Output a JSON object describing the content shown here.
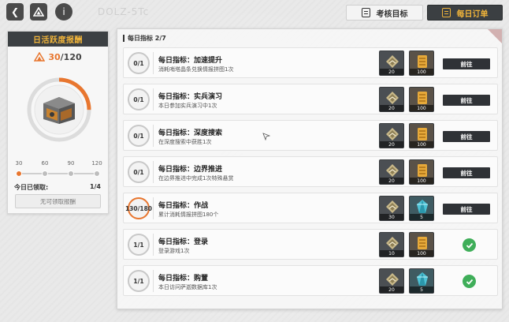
{
  "topbar": {
    "title": "DOLZ-5Tc",
    "tabs": [
      {
        "label": "考核目标",
        "active": false
      },
      {
        "label": "每日订单",
        "active": true
      }
    ]
  },
  "activity": {
    "header": "日活跃度报酬",
    "current": "30",
    "max": "/120",
    "progress_fraction": 0.25,
    "milestones": [
      "30",
      "60",
      "90",
      "120"
    ],
    "today_label": "今日已领取:",
    "today_value": "1/4",
    "claim_button": "无可领取报酬"
  },
  "list": {
    "header": "每日指标 2/7",
    "tasks": [
      {
        "progress": "0/1",
        "title": "每日指标：加速提升",
        "desc": "消耗哨塔晶条兑换情报拼图1次",
        "rewards": [
          {
            "type": "rank-chip",
            "qty": "20"
          },
          {
            "type": "gold-card",
            "qty": "100"
          }
        ],
        "status": "go",
        "button": "前往"
      },
      {
        "progress": "0/1",
        "title": "每日指标：实兵演习",
        "desc": "本日参加实兵演习中1次",
        "rewards": [
          {
            "type": "rank-chip",
            "qty": "20"
          },
          {
            "type": "gold-card",
            "qty": "100"
          }
        ],
        "status": "go",
        "button": "前往"
      },
      {
        "progress": "0/1",
        "title": "每日指标：深度搜索",
        "desc": "在深度搜索中获胜1次",
        "rewards": [
          {
            "type": "rank-chip",
            "qty": "20"
          },
          {
            "type": "gold-card",
            "qty": "100"
          }
        ],
        "status": "go",
        "button": "前往"
      },
      {
        "progress": "0/1",
        "title": "每日指标：边界推进",
        "desc": "在边界推进中完成1次特殊悬赏",
        "rewards": [
          {
            "type": "rank-chip",
            "qty": "20"
          },
          {
            "type": "gold-card",
            "qty": "100"
          }
        ],
        "status": "go",
        "button": "前往"
      },
      {
        "progress": "130/180",
        "title": "每日指标：作战",
        "desc": "累计消耗情报拼图180个",
        "rewards": [
          {
            "type": "rank-chip",
            "qty": "30"
          },
          {
            "type": "crystal",
            "qty": "5"
          }
        ],
        "status": "go",
        "button": "前往"
      },
      {
        "progress": "1/1",
        "title": "每日指标：登录",
        "desc": "登录游戏1次",
        "rewards": [
          {
            "type": "rank-chip",
            "qty": "10"
          },
          {
            "type": "gold-card",
            "qty": "100"
          }
        ],
        "status": "done",
        "button": ""
      },
      {
        "progress": "1/1",
        "title": "每日指标：购置",
        "desc": "本日访问萨迦数据库1次",
        "rewards": [
          {
            "type": "rank-chip",
            "qty": "20"
          },
          {
            "type": "crystal",
            "qty": "5"
          }
        ],
        "status": "done",
        "button": ""
      }
    ]
  },
  "colors": {
    "accent_orange": "#e8762f",
    "header_gold": "#f0b43a",
    "dark": "#2f3236",
    "check_green": "#3fae59"
  }
}
